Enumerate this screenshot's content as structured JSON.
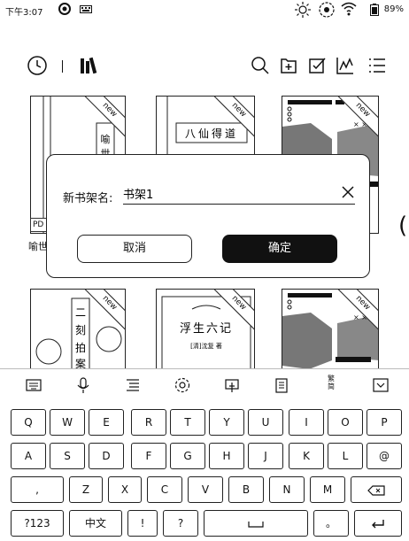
{
  "status": {
    "time": "下午3:07",
    "battery": "89%"
  },
  "books": {
    "row1": [
      {
        "badge": "new",
        "title": "喻世"
      },
      {
        "badge": "new",
        "title": "八仙得道"
      },
      {
        "badge": "new",
        "title": ""
      }
    ],
    "row2": [
      {
        "badge": "new",
        "title": "二刻拍案"
      },
      {
        "badge": "new",
        "title": "浮生六记"
      },
      {
        "badge": "new",
        "title": ""
      }
    ],
    "pdf_tag": "PD",
    "side_label": "喻世",
    "author_line": "[清]沈复 著"
  },
  "dialog": {
    "label": "新书架名:",
    "value": "书架1",
    "cancel": "取消",
    "ok": "确定"
  },
  "keyboard": {
    "row1": [
      "Q",
      "W",
      "E",
      "R",
      "T",
      "Y",
      "U",
      "I",
      "O",
      "P"
    ],
    "row2": [
      "A",
      "S",
      "D",
      "F",
      "G",
      "H",
      "J",
      "K",
      "L",
      "@"
    ],
    "row3": [
      ",",
      "Z",
      "X",
      "C",
      "V",
      "B",
      "N",
      "M"
    ],
    "row4_left": "?123",
    "row4_lang": "中文",
    "row4_excl": "!",
    "row4_q": "?",
    "row4_dot": "。",
    "ime_traditional": "繁\n简"
  }
}
